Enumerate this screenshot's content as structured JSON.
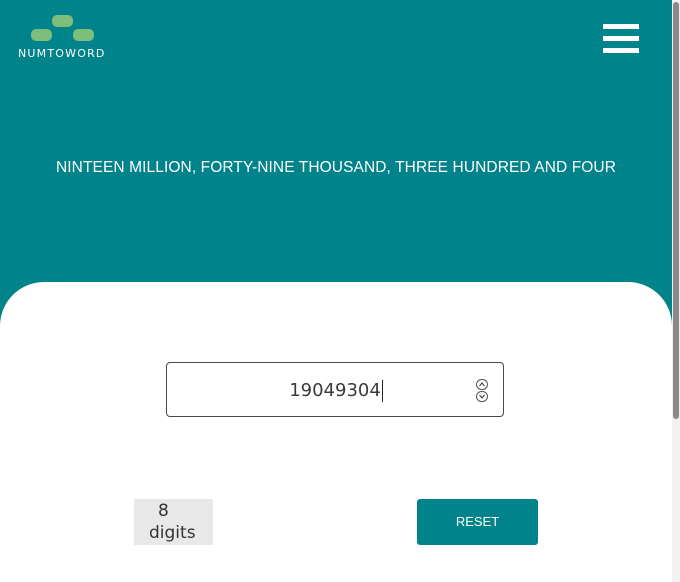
{
  "logo": {
    "text": "NUMTOWORD",
    "color": "#7dbf7a"
  },
  "menu": {
    "icon": "hamburger-menu-icon"
  },
  "result": {
    "words": "NINTEEN MILLION, FORTY-NINE THOUSAND, THREE HUNDRED AND FOUR"
  },
  "input": {
    "value": "19049304",
    "stepper_icons": [
      "chevron-up-icon",
      "chevron-down-icon"
    ]
  },
  "digits": {
    "count": "8",
    "label": "digits"
  },
  "reset": {
    "label": "RESET"
  },
  "colors": {
    "primary": "#00838a",
    "accent": "#7dbf7a",
    "badge_bg": "#e8e8e8"
  }
}
